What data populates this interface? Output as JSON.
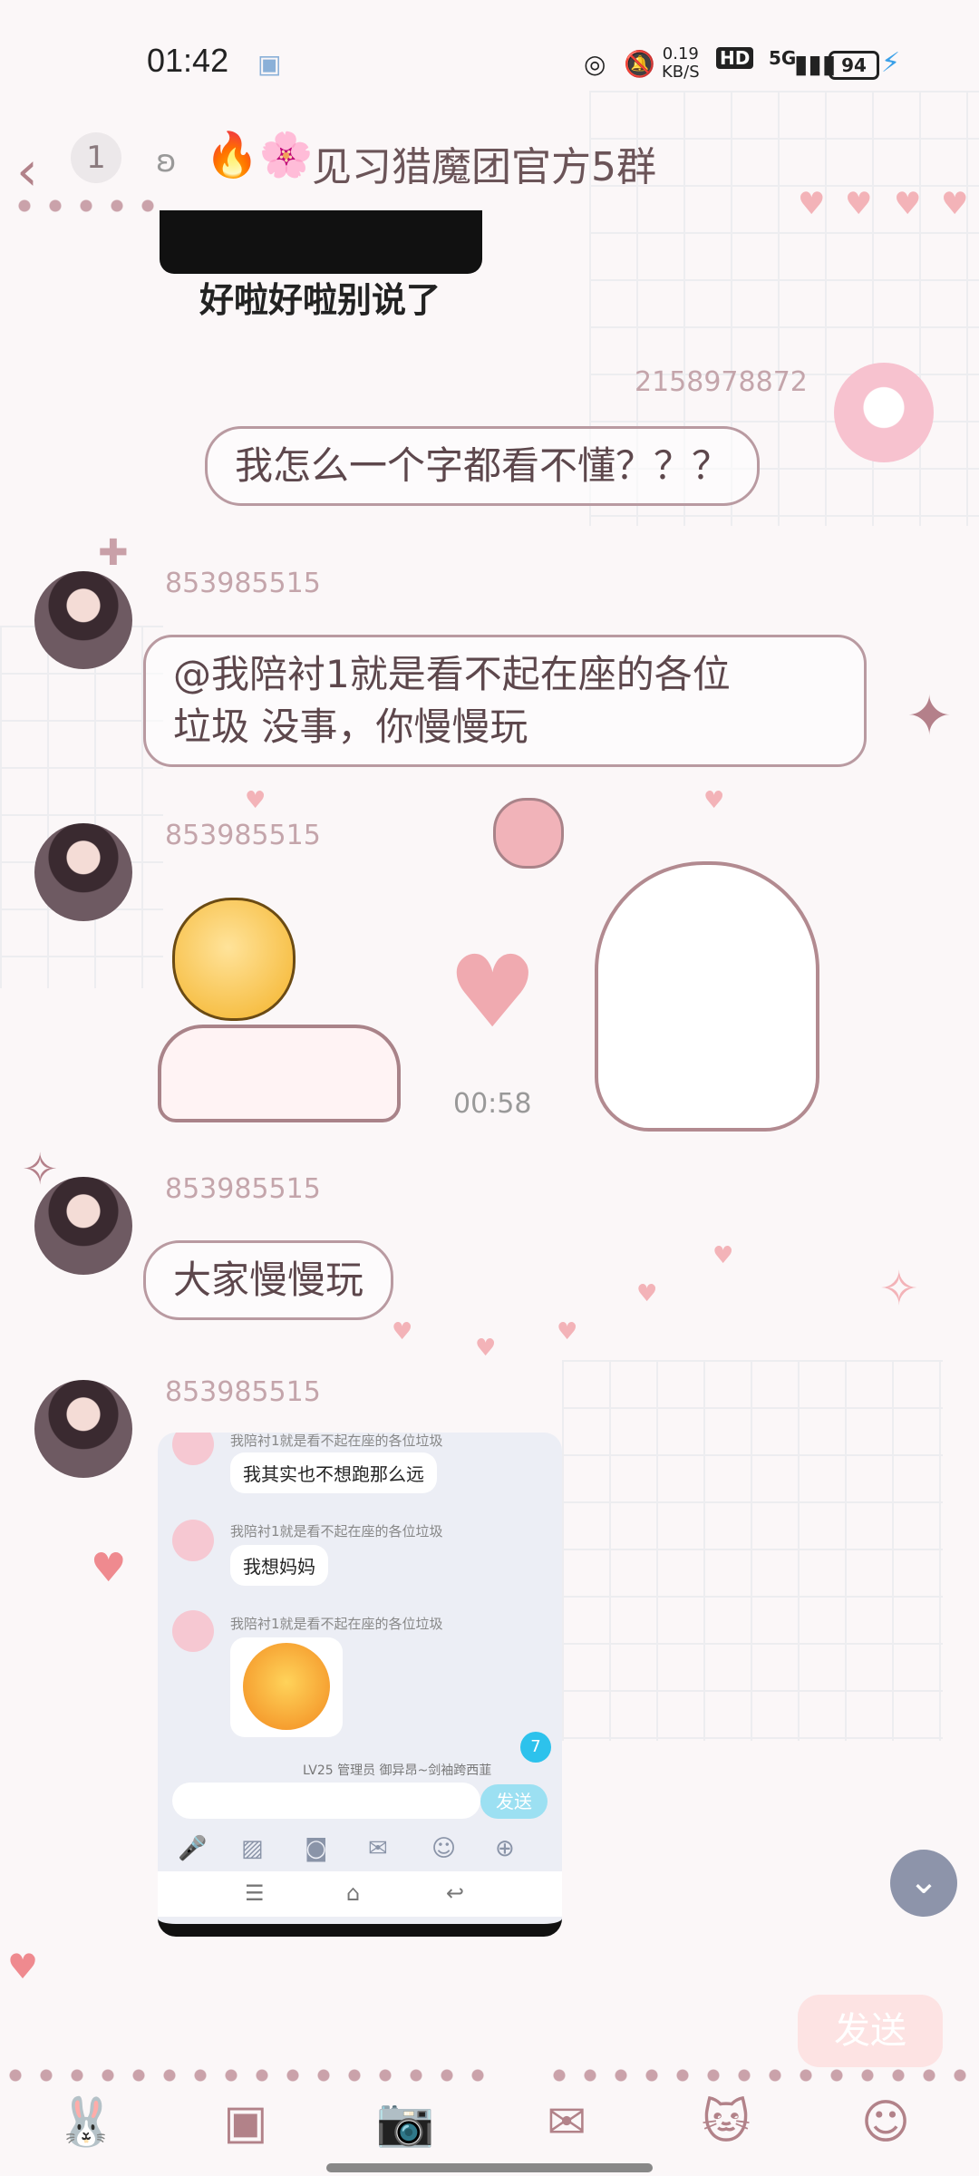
{
  "status_bar": {
    "time": "01:42",
    "net_speed_value": "0.19",
    "net_speed_unit": "KB/S",
    "hd": "HD",
    "network": "5G",
    "battery": "94"
  },
  "header": {
    "unread_count": "1",
    "title": "见习猎魔团官方5群"
  },
  "messages": [
    {
      "type": "image",
      "caption": "好啦好啦别说了"
    },
    {
      "type": "text",
      "sender": "2158978872",
      "text": "我怎么一个字都看不懂？？？",
      "self": true
    },
    {
      "type": "text",
      "sender": "853985515",
      "text_line1": "@我陪衬1就是看不起在座的各位",
      "text_line2": "垃圾 没事，你慢慢玩"
    },
    {
      "type": "sticker",
      "sender": "853985515",
      "timer": "00:58"
    },
    {
      "type": "text",
      "sender": "853985515",
      "text": "大家慢慢玩"
    },
    {
      "type": "screenshot",
      "sender": "853985515"
    }
  ],
  "screenshot": {
    "row_header": "我陪衬1就是看不起在座的各位垃圾",
    "msg1": "我其实也不想跑那么远",
    "msg2": "我想妈妈",
    "badge": "7",
    "admin_line": "LV25 管理员  御异昂~剑袖跨西韮",
    "send_label": "发送"
  },
  "input": {
    "send_label": "发送"
  }
}
